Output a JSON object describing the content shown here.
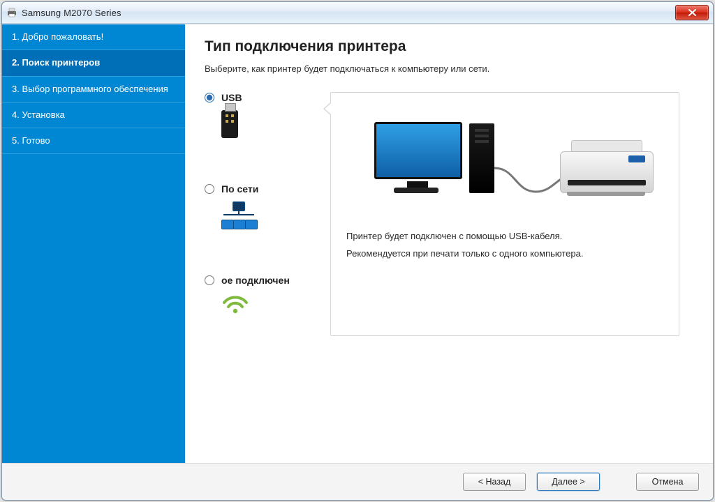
{
  "window": {
    "title": "Samsung M2070 Series"
  },
  "sidebar": {
    "steps": [
      "1. Добро пожаловать!",
      "2. Поиск принтеров",
      "3. Выбор программного обеспечения",
      "4. Установка",
      "5. Готово"
    ],
    "active_index": 1
  },
  "page": {
    "heading": "Тип подключения принтера",
    "subtitle": "Выберите, как принтер будет подключаться к компьютеру или сети."
  },
  "options": {
    "usb": {
      "label": "USB",
      "selected": true
    },
    "network": {
      "label": "По сети",
      "selected": false
    },
    "wireless": {
      "label": "ое подключен",
      "selected": false
    }
  },
  "preview": {
    "line1": "Принтер будет подключен с помощью USB-кабеля.",
    "line2": "Рекомендуется при печати только с одного компьютера."
  },
  "footer": {
    "back": "< Назад",
    "next": "Далее >",
    "cancel": "Отмена"
  }
}
